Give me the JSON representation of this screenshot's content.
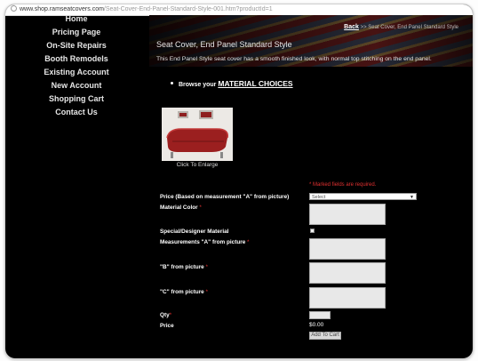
{
  "browser": {
    "url_domain": "www.shop.ramseatcovers.com",
    "url_path": "/Seat-Cover-End-Panel-Standard-Style-001.htm?productId=1"
  },
  "sidebar": {
    "items": [
      {
        "label": "Home"
      },
      {
        "label": "Pricing Page"
      },
      {
        "label": "On-Site Repairs"
      },
      {
        "label": "Booth Remodels"
      },
      {
        "label": "Existing Account"
      },
      {
        "label": "New Account"
      },
      {
        "label": "Shopping Cart"
      },
      {
        "label": "Contact Us"
      }
    ]
  },
  "breadcrumb": {
    "back": "Back",
    "separator": ">>",
    "current": "Seat Cover, End Panel Standard Style"
  },
  "page": {
    "title": "Seat Cover, End Panel Standard Style",
    "description": "This End Panel Style seat cover has a smooth finished look, with normal top stitching on the end panel.",
    "browse_prefix": "Browse your",
    "browse_link": "MATERIAL CHOICES",
    "image_caption": "Click To Enlarge"
  },
  "form": {
    "required_note": "* Marked fields are required.",
    "price_label": "Price (Based on measurement \"A\" from picture)",
    "select_value": "Select",
    "material_color_label": "Material Color",
    "special_material_label": "Special/Designer Material",
    "measurement_a_label": "Measurements \"A\" from picture",
    "measurement_b_label": "\"B\" from picture",
    "measurement_c_label": "\"C\" from picture",
    "qty_label": "Qty",
    "price_text_label": "Price",
    "price_value": "$0.00",
    "add_to_cart": "Add To Cart",
    "required_mark": "*"
  },
  "colors": {
    "background": "#000000",
    "required": "#e03030",
    "banner_red": "#6e1d1d"
  }
}
